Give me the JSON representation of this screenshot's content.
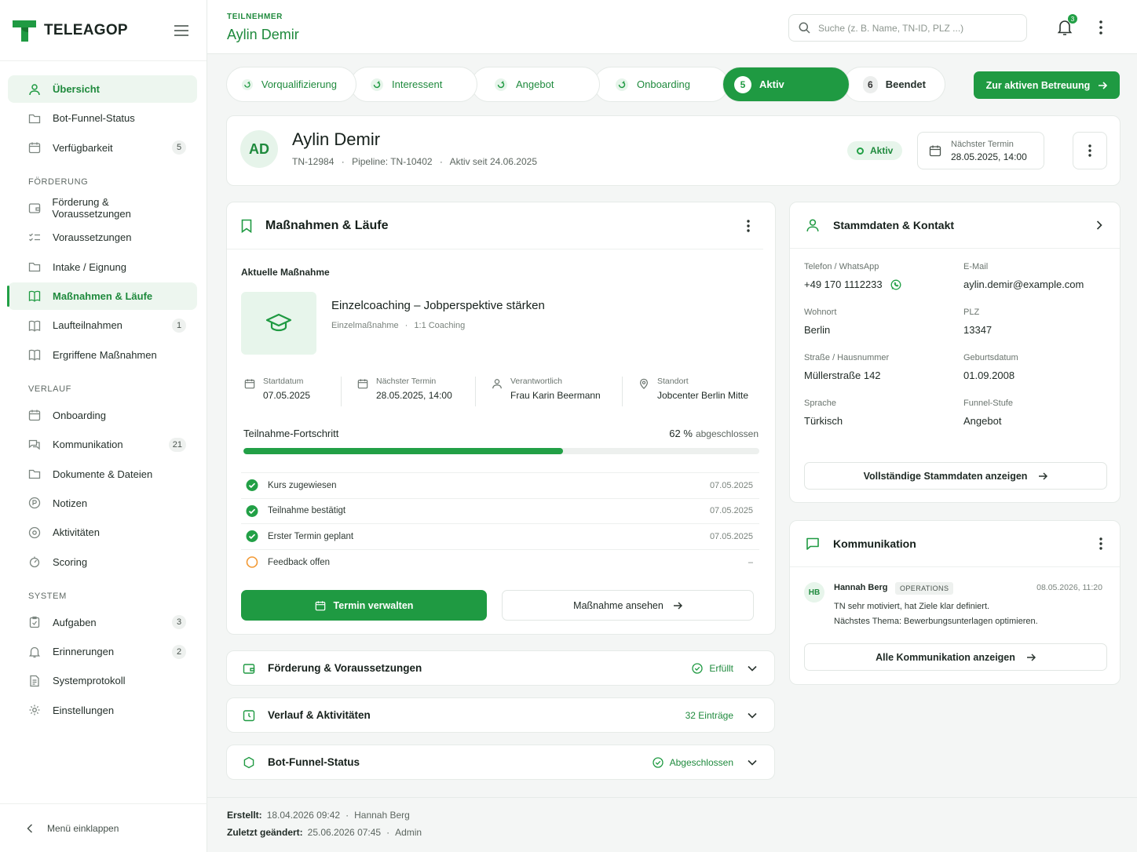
{
  "brand": {
    "name": "TELEAGOP"
  },
  "sidebar": {
    "top_items": [
      {
        "label": "Übersicht"
      },
      {
        "label": "Bot-Funnel-Status"
      },
      {
        "label": "Verfügbarkeit",
        "badge": "5"
      }
    ],
    "sections": [
      {
        "title": "FÖRDERUNG",
        "items": [
          {
            "label": "Förderung & Voraussetzungen"
          },
          {
            "label": "Voraussetzungen"
          },
          {
            "label": "Intake / Eignung"
          },
          {
            "label": "Maßnahmen & Läufe"
          },
          {
            "label": "Laufteilnahmen",
            "badge": "1"
          },
          {
            "label": "Ergriffene Maßnahmen"
          }
        ]
      },
      {
        "title": "VERLAUF",
        "items": [
          {
            "label": "Onboarding"
          },
          {
            "label": "Kommunikation",
            "badge": "21"
          },
          {
            "label": "Dokumente & Dateien"
          },
          {
            "label": "Notizen"
          },
          {
            "label": "Aktivitäten"
          },
          {
            "label": "Scoring"
          }
        ]
      },
      {
        "title": "SYSTEM",
        "items": [
          {
            "label": "Aufgaben",
            "badge": "3"
          },
          {
            "label": "Erinnerungen",
            "badge": "2"
          },
          {
            "label": "Systemprotokoll"
          },
          {
            "label": "Einstellungen"
          }
        ]
      }
    ],
    "collapse_label": "Menü einklappen"
  },
  "header": {
    "crumb": "TEILNEHMER",
    "name": "Aylin Demir",
    "search_placeholder": "Suche (z. B. Name, TN-ID, PLZ ...)",
    "notifications": "3"
  },
  "stepper": {
    "steps": [
      {
        "label": "Vorqualifizierung"
      },
      {
        "label": "Interessent"
      },
      {
        "label": "Angebot"
      },
      {
        "label": "Onboarding"
      },
      {
        "label": "Aktiv",
        "num": "5"
      },
      {
        "label": "Beendet",
        "num": "6"
      }
    ],
    "cta": "Zur aktiven Betreuung"
  },
  "profile": {
    "initials": "AD",
    "name": "Aylin Demir",
    "id": "TN-12984",
    "pipeline": "Pipeline: TN-10402",
    "since": "Aktiv seit 24.06.2025",
    "status": "Aktiv",
    "next_label": "Nächster Termin",
    "next_value": "28.05.2025, 14:00"
  },
  "measures": {
    "title": "Maßnahmen & Läufe",
    "current_label": "Aktuelle Maßnahme",
    "name": "Einzelcoaching – Jobperspektive stärken",
    "type": "Einzelmaßnahme",
    "format": "1:1 Coaching",
    "facts": [
      {
        "label": "Startdatum",
        "value": "07.05.2025"
      },
      {
        "label": "Nächster Termin",
        "value": "28.05.2025, 14:00"
      },
      {
        "label": "Verantwortlich",
        "value": "Frau Karin Beermann"
      },
      {
        "label": "Standort",
        "value": "Jobcenter Berlin Mitte"
      }
    ],
    "progress_label": "Teilnahme-Fortschritt",
    "progress_pct": "62 %",
    "progress_suffix": "abgeschlossen",
    "progress_value": 0.62,
    "checklist": [
      {
        "label": "Kurs zugewiesen",
        "date": "07.05.2025"
      },
      {
        "label": "Teilnahme bestätigt",
        "date": "07.05.2025"
      },
      {
        "label": "Erster Termin geplant",
        "date": "07.05.2025"
      },
      {
        "label": "Feedback offen",
        "date": "–"
      }
    ],
    "btn_primary": "Termin verwalten",
    "btn_secondary": "Maßnahme ansehen"
  },
  "accordions": [
    {
      "title": "Förderung & Voraussetzungen",
      "status": "Erfüllt"
    },
    {
      "title": "Verlauf & Aktivitäten",
      "status": "32 Einträge"
    },
    {
      "title": "Bot-Funnel-Status",
      "status": "Abgeschlossen"
    }
  ],
  "master": {
    "title": "Stammdaten & Kontakt",
    "fields": [
      {
        "label": "Telefon / WhatsApp",
        "value": "+49 170 1112233"
      },
      {
        "label": "E-Mail",
        "value": "aylin.demir@example.com"
      },
      {
        "label": "Wohnort",
        "value": "Berlin"
      },
      {
        "label": "PLZ",
        "value": "13347"
      },
      {
        "label": "Straße / Hausnummer",
        "value": "Müllerstraße 142"
      },
      {
        "label": "Geburtsdatum",
        "value": "01.09.2008"
      },
      {
        "label": "Sprache",
        "value": "Türkisch"
      },
      {
        "label": "Funnel-Stufe",
        "value": "Angebot"
      }
    ],
    "btn": "Vollständige Stammdaten anzeigen"
  },
  "comm": {
    "title": "Kommunikation",
    "initials": "HB",
    "author": "Hannah Berg",
    "tag": "OPERATIONS",
    "time": "08.05.2026, 11:20",
    "line1": "TN sehr motiviert, hat Ziele klar definiert.",
    "line2": "Nächstes Thema: Bewerbungsunterlagen optimieren.",
    "btn": "Alle Kommunikation anzeigen"
  },
  "footer": {
    "created_label": "Erstellt:",
    "created": "18.04.2026 09:42",
    "created_by": "Hannah Berg",
    "changed_label": "Zuletzt geändert:",
    "changed": "25.06.2026 07:45",
    "changed_by": "Admin"
  },
  "colors": {
    "accent": "#1f9a42",
    "warning": "#f29a36"
  }
}
